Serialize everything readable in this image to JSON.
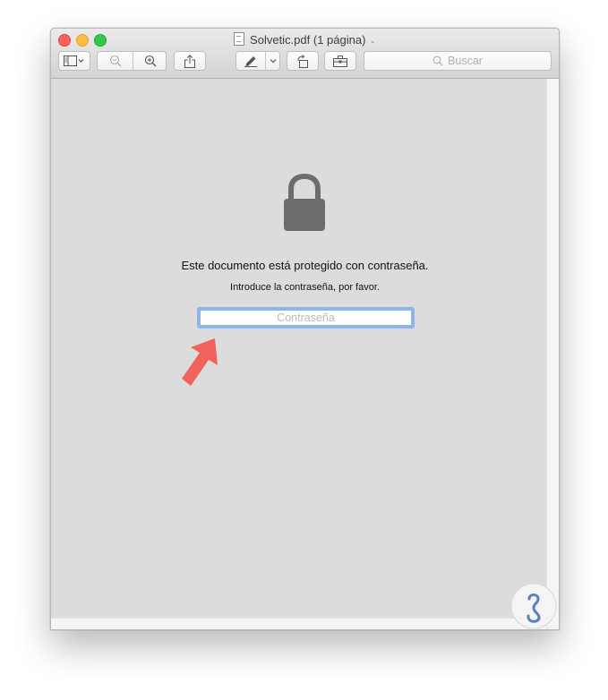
{
  "window": {
    "title": "Solvetic.pdf (1 página)",
    "title_chevron": "⌄"
  },
  "toolbar": {
    "search_placeholder": "Buscar"
  },
  "icons": {
    "sidebar": "sidebar-icon",
    "zoom_out": "zoom-out-icon",
    "zoom_in": "zoom-in-icon",
    "share": "share-icon",
    "markup": "pen-icon",
    "rotate": "rotate-icon",
    "toolbox": "toolbox-icon",
    "lock": "lock-icon"
  },
  "protection": {
    "message": "Este documento está protegido con contraseña.",
    "prompt": "Introduce la contraseña, por favor.",
    "password_placeholder": "Contraseña"
  },
  "colors": {
    "close": "#fc605b",
    "minimize": "#fdbc40",
    "maximize": "#34c84a",
    "focus_ring": "#8ab4ea",
    "arrow": "#f0625c",
    "watermark": "#5a7fbf"
  }
}
